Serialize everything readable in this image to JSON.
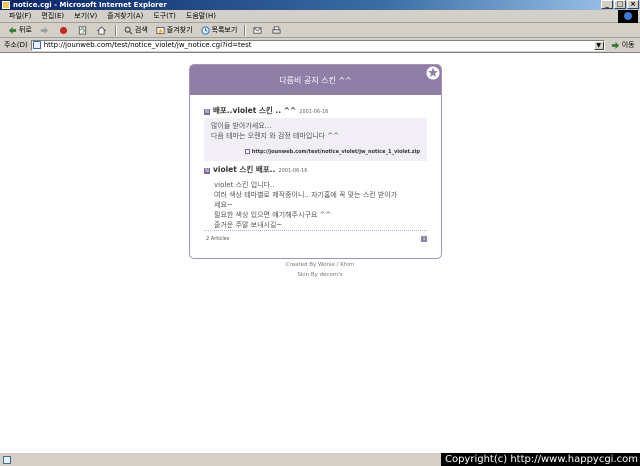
{
  "window": {
    "title": "notice.cgi - Microsoft Internet Explorer"
  },
  "menu": [
    "파일(F)",
    "편집(E)",
    "보기(V)",
    "즐겨찾기(A)",
    "도구(T)",
    "도움말(H)"
  ],
  "toolbar": {
    "back": "뒤로",
    "search": "검색",
    "favorites": "즐겨찾기",
    "history": "목록보기"
  },
  "address": {
    "label": "주소(D)",
    "url": "http://jounweb.com/test/notice_violet/jw_notice.cgi?id=test",
    "go": "이동"
  },
  "card": {
    "header_title": "다름비 공지 스킨 ^^",
    "posts": [
      {
        "title": "배포..violet 스킨 .. ^^",
        "date": "2001-06-16",
        "lines": [
          "많이들 받아가세요...",
          "다음 테마는 오렌지 와 검정 테마입니다 ^^"
        ],
        "link": "http://jounweb.com/test/notice_violet/jw_notice_1_violet.zip"
      },
      {
        "title": "violet 스킨 배포..",
        "date": "2001-06-16",
        "lines": [
          "violet 스킨 입니다..",
          "여러 색상 테마별로 제작중이니.. 자기홈에 꼭 맞는 스킨 받아가",
          "세요~",
          "필요한 색상 있으면 얘기해주시구요 ^^",
          "즐거운 주말 보내시길~"
        ]
      }
    ],
    "article_count": "2 Articles",
    "page_number": "1"
  },
  "credits": {
    "created": "Created By Wonie / Khim",
    "skin": "Skin By decom's"
  },
  "statusbar": {
    "copyright": "Copyright(c) http://www.happycgi.com"
  }
}
